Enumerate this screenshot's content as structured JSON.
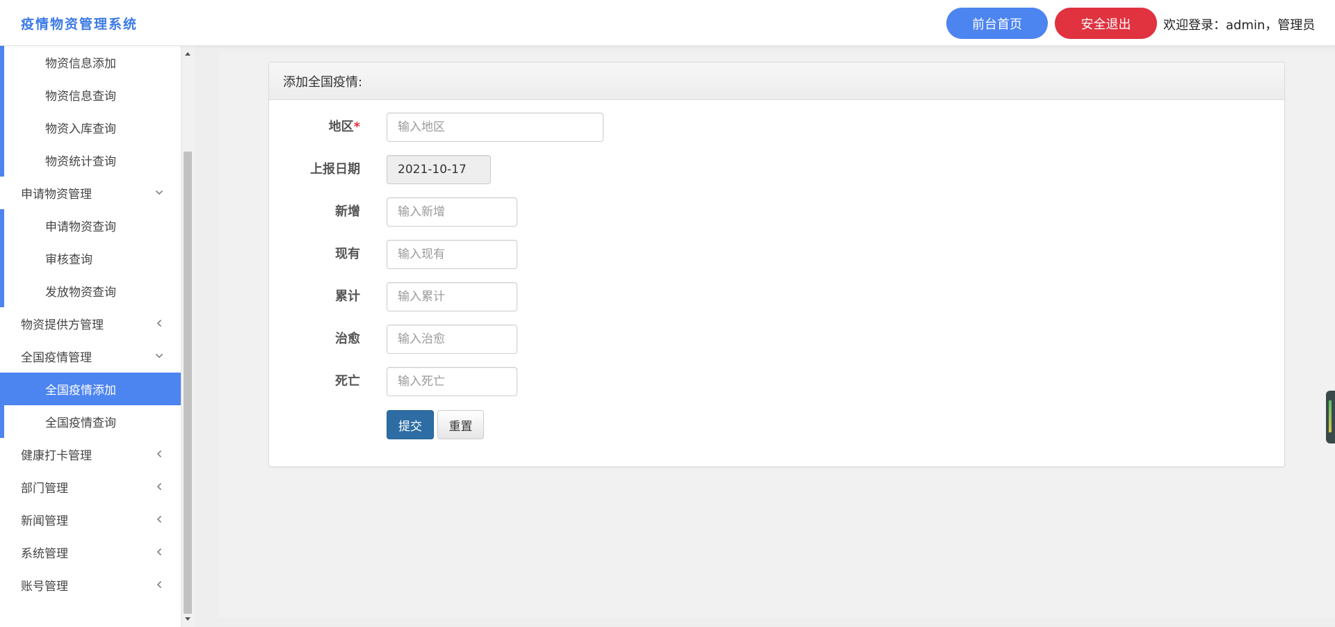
{
  "header": {
    "brand": "疫情物资管理系统",
    "home_button": "前台首页",
    "logout_button": "安全退出",
    "welcome": "欢迎登录：admin，管理员"
  },
  "sidebar": {
    "items": [
      {
        "label": "物资信息添加",
        "level": "sub"
      },
      {
        "label": "物资信息查询",
        "level": "sub"
      },
      {
        "label": "物资入库查询",
        "level": "sub"
      },
      {
        "label": "物资统计查询",
        "level": "sub"
      },
      {
        "label": "申请物资管理",
        "level": "group",
        "arrow": "chevron-down-icon"
      },
      {
        "label": "申请物资查询",
        "level": "sub"
      },
      {
        "label": "审核查询",
        "level": "sub"
      },
      {
        "label": "发放物资查询",
        "level": "sub"
      },
      {
        "label": "物资提供方管理",
        "level": "group",
        "arrow": "chevron-left-icon"
      },
      {
        "label": "全国疫情管理",
        "level": "group",
        "arrow": "chevron-down-icon"
      },
      {
        "label": "全国疫情添加",
        "level": "sub",
        "active": true
      },
      {
        "label": "全国疫情查询",
        "level": "sub"
      },
      {
        "label": "健康打卡管理",
        "level": "group",
        "arrow": "chevron-left-icon"
      },
      {
        "label": "部门管理",
        "level": "group",
        "arrow": "chevron-left-icon"
      },
      {
        "label": "新闻管理",
        "level": "group",
        "arrow": "chevron-left-icon"
      },
      {
        "label": "系统管理",
        "level": "group",
        "arrow": "chevron-left-icon"
      },
      {
        "label": "账号管理",
        "level": "group",
        "arrow": "chevron-left-icon"
      }
    ]
  },
  "form": {
    "title": "添加全国疫情:",
    "region_label": "地区",
    "required_mark": "*",
    "region_placeholder": "输入地区",
    "date_label": "上报日期",
    "date_value": "2021-10-17",
    "new_label": "新增",
    "new_placeholder": "输入新增",
    "current_label": "现有",
    "current_placeholder": "输入现有",
    "total_label": "累计",
    "total_placeholder": "输入累计",
    "cured_label": "治愈",
    "cured_placeholder": "输入治愈",
    "dead_label": "死亡",
    "dead_placeholder": "输入死亡",
    "submit_button": "提交",
    "reset_button": "重置"
  },
  "colors": {
    "accent": "#4c84f0",
    "danger": "#e0323f",
    "primary_button": "#2e6da4"
  }
}
